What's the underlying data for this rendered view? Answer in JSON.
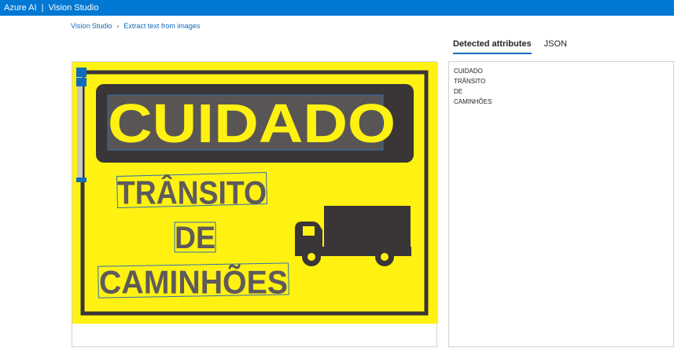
{
  "topbar": {
    "product": "Azure AI",
    "separator": "|",
    "app": "Vision Studio"
  },
  "breadcrumb": {
    "home": "Vision Studio",
    "chevron": "›",
    "current": "Extract text from images"
  },
  "tabs": [
    {
      "label": "Detected attributes",
      "active": true
    },
    {
      "label": "JSON",
      "active": false
    }
  ],
  "sign": {
    "line1": "CUIDADO",
    "line2": "TRÂNSITO",
    "line3": "DE",
    "line4": "CAMINHÕES",
    "icon": "truck-icon",
    "colors": {
      "background": "#fff212",
      "panel": "#3a3536",
      "text": "#5f5a5b",
      "highlight": "#fff212",
      "box": "#2f6fb3",
      "handle": "#0f6cbd"
    }
  },
  "detected_lines": [
    "CUIDADO",
    "TRÂNSITO",
    "DE",
    "CAMINHÕES"
  ]
}
